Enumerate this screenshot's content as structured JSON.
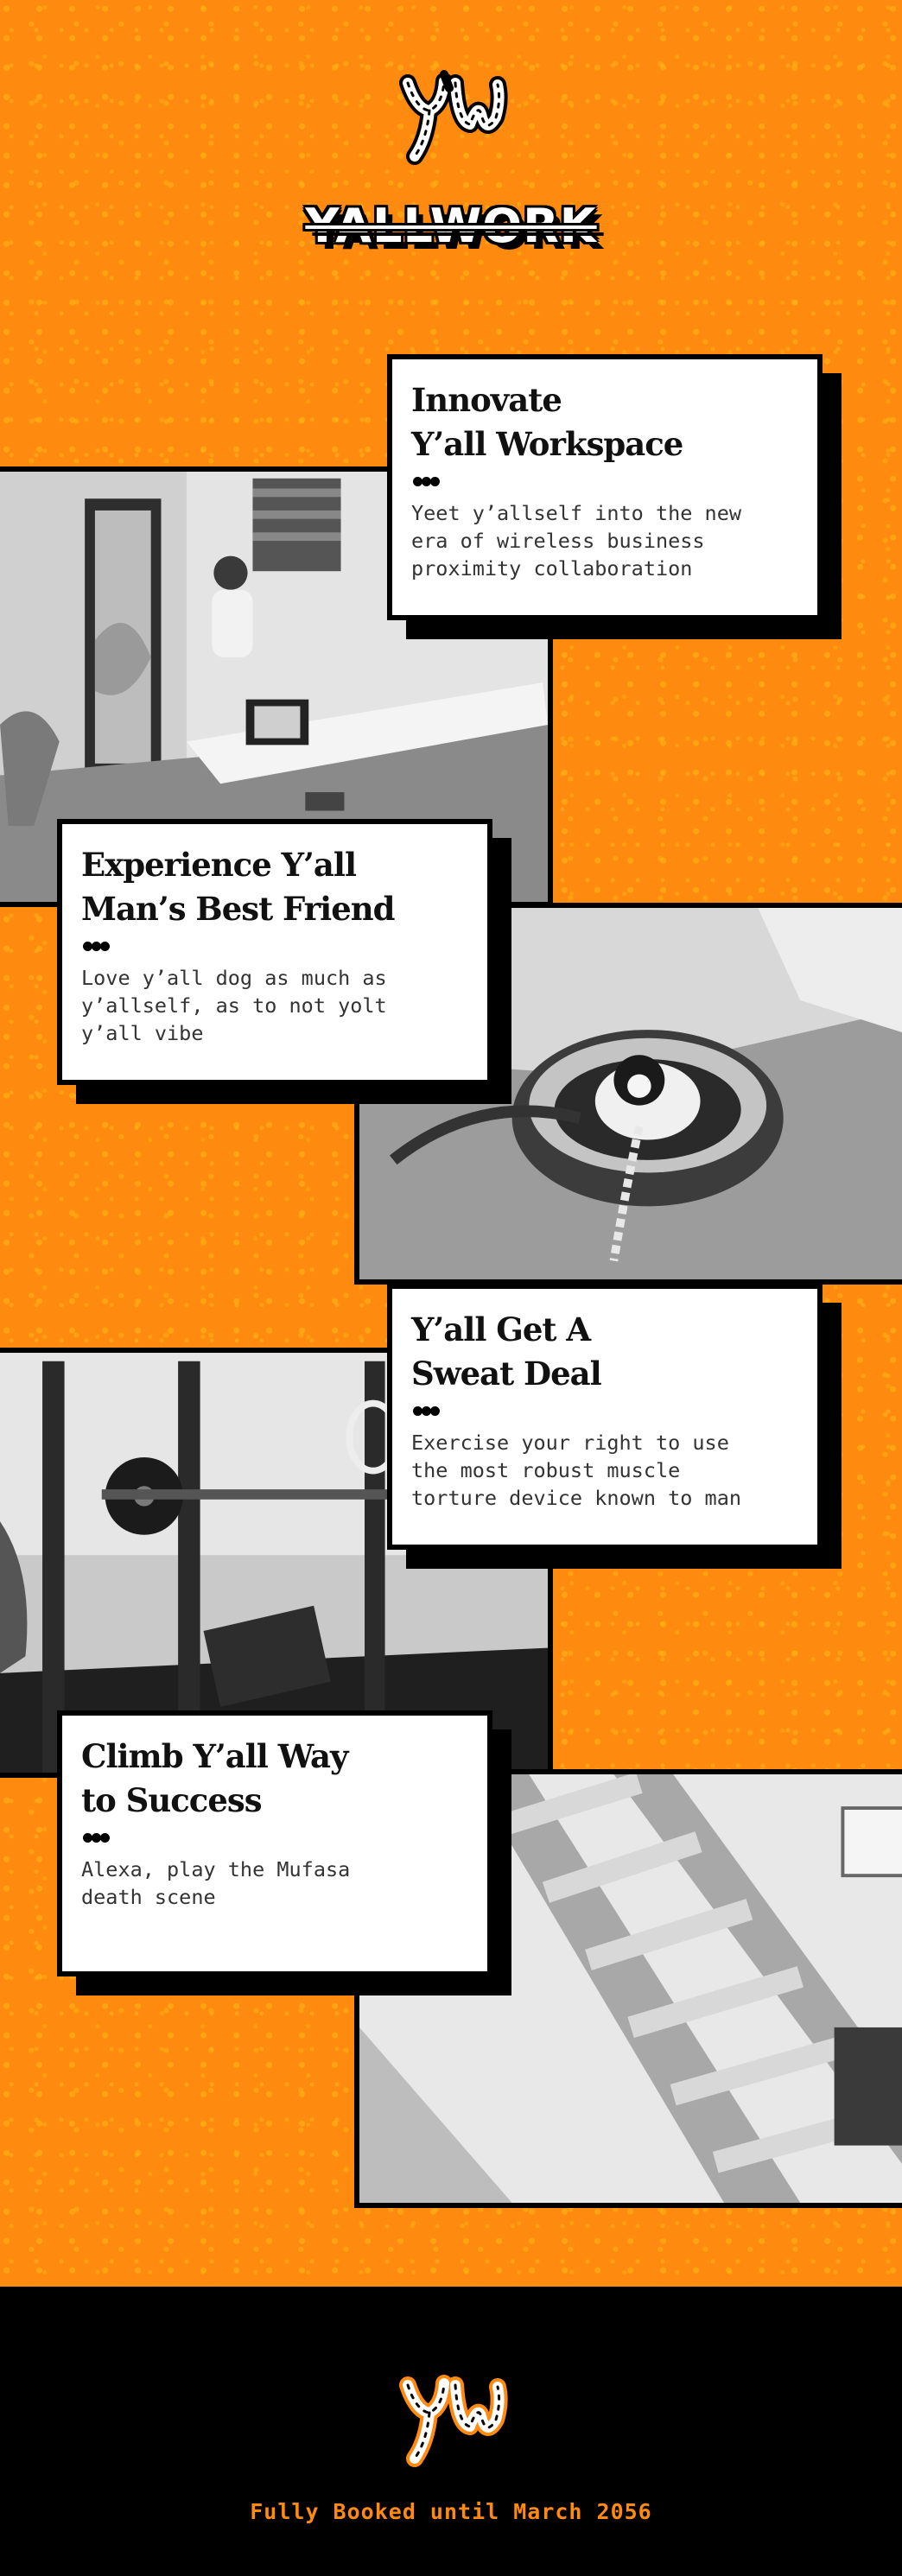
{
  "brand": {
    "logo_icon": "yw-rope-monogram-icon",
    "logo_text": "y'w",
    "wordmark": "YALLWORK"
  },
  "colors": {
    "background": "#ff8a10",
    "background_speckle": "#ffb914",
    "ink": "#000000",
    "card": "#ffffff",
    "footer_text": "#ff8a10"
  },
  "features": [
    {
      "title_lines": [
        "Innovate",
        "Y’all Workspace"
      ],
      "divider_icon": "three-dot-divider-icon",
      "body": "Yeet y’allself into the new\nera of wireless business\nproximity collaboration",
      "photo_icon": "office-desk-photo"
    },
    {
      "title_lines": [
        "Experience Y’all",
        "Man’s Best Friend"
      ],
      "divider_icon": "three-dot-divider-icon",
      "body": "Love y’all dog as much as\ny’allself, as to not yolt\ny’all vibe",
      "photo_icon": "dog-bed-photo"
    },
    {
      "title_lines": [
        "Y’all Get A",
        "Sweat Deal"
      ],
      "divider_icon": "three-dot-divider-icon",
      "body": "Exercise your right to use\nthe most robust muscle\ntorture device known to man",
      "photo_icon": "gym-rack-photo"
    },
    {
      "title_lines": [
        "Climb Y’all Way",
        "to Success"
      ],
      "divider_icon": "three-dot-divider-icon",
      "body": "Alexa, play the Mufasa\ndeath scene",
      "photo_icon": "ladder-photo"
    }
  ],
  "footer": {
    "logo_icon": "yw-rope-monogram-icon",
    "status_text": "Fully Booked until March 2056"
  }
}
